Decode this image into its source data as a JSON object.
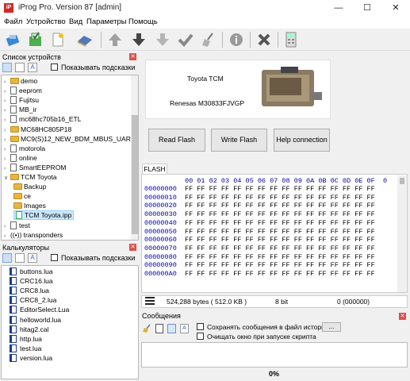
{
  "window": {
    "title": "iProg Pro. Version 87 [admin]",
    "app_icon": "iP"
  },
  "menu": [
    "Файл",
    "Устройство",
    "Вид",
    "Параметры",
    "Помощь"
  ],
  "toolbar": [
    "open-icon",
    "save-icon",
    "new-file-icon",
    "eraser-icon",
    "arrow-up-icon",
    "arrow-down-icon",
    "arrow-down-light-icon",
    "checkmark-icon",
    "broom-icon",
    "info-icon",
    "delete-icon",
    "calculator-icon"
  ],
  "device_panel": {
    "title": "Список устройств",
    "hints_label": "Показывать подсказки",
    "items": [
      {
        "label": "demo",
        "type": "folder",
        "level": 0,
        "arrow": ">"
      },
      {
        "label": "eeprom",
        "type": "doc",
        "level": 0,
        "arrow": ">"
      },
      {
        "label": "Fujitsu",
        "type": "doc",
        "level": 0,
        "arrow": ">"
      },
      {
        "label": "MB_ir",
        "type": "doc",
        "level": 0,
        "arrow": ">"
      },
      {
        "label": "mc68hc705b16_ETL",
        "type": "doc",
        "level": 0,
        "arrow": ">"
      },
      {
        "label": "MC68HC805P18",
        "type": "folder",
        "level": 0,
        "arrow": ">"
      },
      {
        "label": "MC9(S)12_NEW_BDM_MBUS_UART",
        "type": "folder",
        "level": 0,
        "arrow": ">"
      },
      {
        "label": "motorola",
        "type": "doc",
        "level": 0,
        "arrow": ">"
      },
      {
        "label": "online",
        "type": "doc",
        "level": 0,
        "arrow": ">"
      },
      {
        "label": "SmartEEPROM",
        "type": "doc",
        "level": 0,
        "arrow": ">"
      },
      {
        "label": "TCM Toyota",
        "type": "folder",
        "level": 0,
        "arrow": "v"
      },
      {
        "label": "Backup",
        "type": "folder",
        "level": 1,
        "arrow": ""
      },
      {
        "label": "ce",
        "type": "folder",
        "level": 1,
        "arrow": ""
      },
      {
        "label": "Images",
        "type": "folder",
        "level": 1,
        "arrow": ""
      },
      {
        "label": "TCM Toyota.ipp",
        "type": "file",
        "level": 1,
        "arrow": "",
        "selected": true
      },
      {
        "label": "test",
        "type": "doc",
        "level": 0,
        "arrow": ">"
      },
      {
        "label": "transponders",
        "type": "radio",
        "level": 0,
        "arrow": ">"
      }
    ]
  },
  "calc_panel": {
    "title": "Калькуляторы",
    "hints_label": "Показывать подсказки",
    "items": [
      "buttons.lua",
      "CRC16.lua",
      "CRC8.lua",
      "CRC8_2.lua",
      "EditorSelect.Lua",
      "helloworld.lua",
      "hitag2.cal",
      "http.lua",
      "test.lua",
      "version.lua"
    ]
  },
  "device_info": {
    "name": "Toyota TCM",
    "chip": "Renesas M30833FJVGP"
  },
  "buttons": {
    "read": "Read Flash",
    "write": "Write Flash",
    "help": "Help connection"
  },
  "flash": {
    "tab": "FLASH",
    "columns": [
      "00",
      "01",
      "02",
      "03",
      "04",
      "05",
      "06",
      "07",
      "08",
      "09",
      "0A",
      "0B",
      "0C",
      "0D",
      "0E",
      "0F"
    ],
    "col_extra": "0",
    "addresses": [
      "00000000",
      "00000010",
      "00000020",
      "00000030",
      "00000040",
      "00000050",
      "00000060",
      "00000070",
      "00000080",
      "00000090",
      "000000A0"
    ],
    "byte_value": "FF"
  },
  "status": {
    "size": "524,288 bytes ( 512.0 KB )",
    "bits": "8 bit",
    "pos": "0 (000000)"
  },
  "messages": {
    "title": "Сообщения",
    "save_label": "Сохранять сообщения в файл истории",
    "browse": "...",
    "clear_label": "Очищать окно при запуске скрипта",
    "progress": "0%"
  }
}
